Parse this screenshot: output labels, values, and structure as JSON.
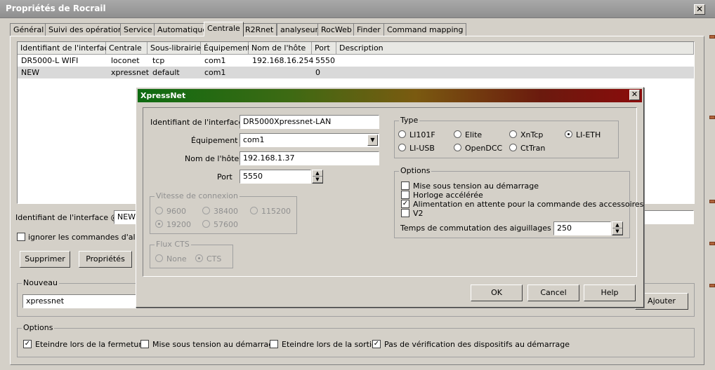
{
  "window": {
    "title": "Propriétés de Rocrail",
    "close_glyph": "✕"
  },
  "tabs": [
    "Général",
    "Suivi des opérations",
    "Service",
    "Automatique",
    "Centrale",
    "R2Rnet",
    "analyseur",
    "RocWeb",
    "Finder",
    "Command mapping"
  ],
  "active_tab": "Centrale",
  "table": {
    "columns": [
      "Identifiant de l'interface",
      "Centrale",
      "Sous-librairie",
      "Équipement",
      "Nom de l'hôte",
      "Port",
      "Description"
    ],
    "rows": [
      [
        "DR5000-L WIFI",
        "loconet",
        "tcp",
        "com1",
        "192.168.16.254",
        "5550",
        ""
      ],
      [
        "NEW",
        "xpressnet",
        "default",
        "com1",
        "",
        "0",
        ""
      ]
    ]
  },
  "main": {
    "iid_label": "Identifiant de l'interface @",
    "iid_value": "NEW",
    "ignore_label": "ignorer les commandes d'aliment",
    "delete_button": "Supprimer",
    "props_button": "Propriétés",
    "new_group": "Nouveau",
    "new_value": "xpressnet",
    "add_button": "Ajouter"
  },
  "options": {
    "title": "Options",
    "items": [
      {
        "label": "Eteindre lors de la fermeture",
        "checked": true
      },
      {
        "label": "Mise sous tension au démarrage",
        "checked": false
      },
      {
        "label": "Eteindre lors de la sortie",
        "checked": false
      },
      {
        "label": "Pas de vérification des dispositifs au démarrage",
        "checked": true
      }
    ]
  },
  "dialog": {
    "title": "XpressNet",
    "close_glyph": "✕",
    "iid_label": "Identifiant de l'interface",
    "iid_value": "DR5000Xpressnet-LAN",
    "device_label": "Équipement",
    "device_value": "com1",
    "host_label": "Nom de l'hôte",
    "host_value": "192.168.1.37",
    "port_label": "Port",
    "port_value": "5550",
    "speed_group": "Vitesse de connexion",
    "speeds": [
      {
        "label": "9600",
        "selected": false
      },
      {
        "label": "38400",
        "selected": false
      },
      {
        "label": "115200",
        "selected": false
      },
      {
        "label": "19200",
        "selected": true
      },
      {
        "label": "57600",
        "selected": false
      }
    ],
    "cts_group": "Flux CTS",
    "cts": [
      {
        "label": "None",
        "selected": false
      },
      {
        "label": "CTS",
        "selected": true
      }
    ],
    "type_group": "Type",
    "types": [
      {
        "label": "LI101F",
        "selected": false
      },
      {
        "label": "Elite",
        "selected": false
      },
      {
        "label": "XnTcp",
        "selected": false
      },
      {
        "label": "LI-ETH",
        "selected": true
      },
      {
        "label": "LI-USB",
        "selected": false
      },
      {
        "label": "OpenDCC",
        "selected": false
      },
      {
        "label": "CtTran",
        "selected": false
      }
    ],
    "options_group": "Options",
    "options": [
      {
        "label": "Mise sous tension au démarrage",
        "checked": false
      },
      {
        "label": "Horloge accélérée",
        "checked": false
      },
      {
        "label": "Alimentation en attente pour la commande des accessoires",
        "checked": true
      },
      {
        "label": "V2",
        "checked": false
      }
    ],
    "switch_label": "Temps de commutation des aiguillages (ms)",
    "switch_value": "250",
    "ok": "OK",
    "cancel": "Cancel",
    "help": "Help"
  },
  "icons": {
    "check": "✓",
    "dropdown": "▼",
    "up": "▲",
    "down": "▼"
  }
}
